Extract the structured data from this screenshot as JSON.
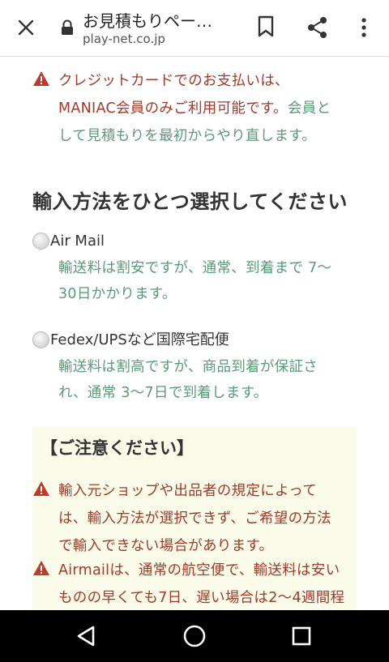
{
  "browser": {
    "title": "お見積もりペー…",
    "url": "play-net.co.jp",
    "icons": [
      "close-icon",
      "lock-icon",
      "bookmark-icon",
      "share-icon",
      "more-vert-icon"
    ]
  },
  "payment_notice": {
    "line1": "クレジットカードでのお支払いは、",
    "line2_red": "MANIAC会員のみご利用可能です。",
    "line2_green": "会員と",
    "line3_green": "して見積もりを最初からやり直します。"
  },
  "import_method": {
    "heading": "輸入方法をひとつ選択してください",
    "options": [
      {
        "label": "Air Mail",
        "desc_line1": "輸送料は割安ですが、通常、到着まで 7〜",
        "desc_line2": "30日かかります。",
        "selected": false
      },
      {
        "label": "Fedex/UPSなど国際宅配便",
        "desc_line1": "輸送料は割高ですが、商品到着が保証さ",
        "desc_line2": "れ、通常 3〜7日で到着します。",
        "selected": false
      }
    ]
  },
  "caution": {
    "title": "【ご注意ください】",
    "items": [
      {
        "line1": "輸入元ショップや出品者の規定によって",
        "line2": "は、輸入方法が選択できず、ご希望の方法",
        "line3": "で輸入できない場合があります。"
      },
      {
        "line1": "Airmailは、通常の航空便で、輸送料は安い",
        "line2": "ものの早くても7日、遅い場合は2〜4週間程"
      }
    ]
  },
  "colors": {
    "warning_red": "#c0392b",
    "text_red": "#a0392a",
    "text_green": "#5a9a77",
    "notice_bg": "#fbfbea"
  },
  "nav": {
    "icons": [
      "back-icon",
      "home-icon",
      "recents-icon"
    ]
  }
}
